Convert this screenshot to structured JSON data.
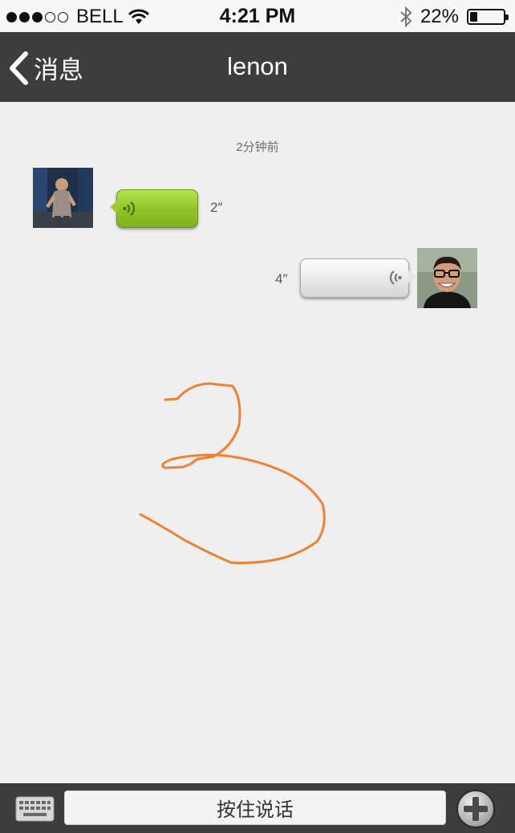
{
  "status_bar": {
    "carrier": "BELL",
    "signal_filled": 3,
    "signal_total": 5,
    "time": "4:21 PM",
    "battery": "22%",
    "battery_level": 0.22
  },
  "nav": {
    "back_label": "消息",
    "title": "lenon"
  },
  "conversation": {
    "timestamp": "2分钟前",
    "messages": [
      {
        "side": "left",
        "type": "voice",
        "duration": "2″",
        "bubble_color": "#9bcb33"
      },
      {
        "side": "right",
        "type": "voice",
        "duration": "4″",
        "bubble_color": "#e4e4e4"
      }
    ]
  },
  "annotation": {
    "color": "#f08132"
  },
  "input_bar": {
    "hold_to_talk_label": "按住说话"
  },
  "icons": [
    "wifi-icon",
    "bluetooth-icon",
    "battery-icon",
    "back-chevron-icon",
    "voice-wave-icon",
    "keyboard-icon",
    "plus-icon"
  ]
}
